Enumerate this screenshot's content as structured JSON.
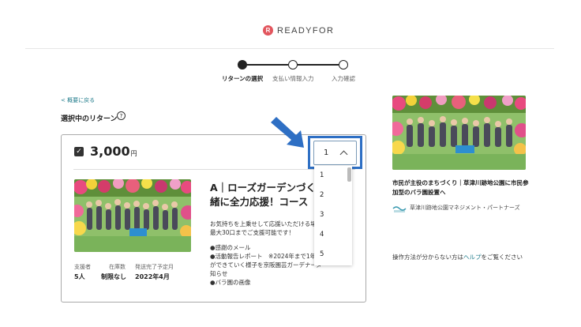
{
  "header": {
    "logo_mark": "R",
    "logo_text": "READYFOR"
  },
  "stepper": {
    "steps": [
      {
        "label": "リターンの選択",
        "active": true
      },
      {
        "label": "支払い情報入力",
        "active": false
      },
      {
        "label": "入力確認",
        "active": false
      }
    ]
  },
  "back_link": "< 概要に戻る",
  "section_title": "選択中のリターン",
  "help_icon_glyph": "?",
  "card": {
    "price": "3,000",
    "yen": "円",
    "stats": [
      {
        "label": "支援者",
        "value": "5人"
      },
      {
        "label": "在庫数",
        "value": "制限なし"
      },
      {
        "label": "発送完了予定月",
        "value": "2022年4月"
      }
    ],
    "title_lines": [
      "A｜ローズガーデンづく",
      "緒に全力応援！コース"
    ],
    "description_lines": [
      "お気持ちを上乗せして応援いただける場",
      "最大30口までご支援可能です！"
    ],
    "items": [
      "●感謝のメール",
      "●活動報告レポート　※2024年まで1年",
      "ができていく様子を京阪園芸ガーデナーズBM",
      "知らせ",
      "●バラ園の画像"
    ]
  },
  "quantity": {
    "selected": "1",
    "options": [
      "1",
      "2",
      "3",
      "4",
      "5"
    ]
  },
  "sidebar": {
    "project_title": "市民が主役のまちづくり｜草津川跡地公園に市民参加型のバラ園設置へ",
    "partner_icon": "草津川跡地公園",
    "partner": "草津川跡地公園マネジメント・パートナーズ",
    "help_prefix": "操作方法が分からない方は",
    "help_link": "ヘルプ",
    "help_suffix": "をご覧ください"
  },
  "colors": {
    "accent_teal": "#1f7b8b",
    "highlight_blue": "#2e6fc4",
    "logo_red": "#e2555d"
  },
  "icons": [
    "help-circle-icon",
    "checkbox-checked-icon",
    "chevron-up-icon",
    "arrow-down-right-icon"
  ]
}
